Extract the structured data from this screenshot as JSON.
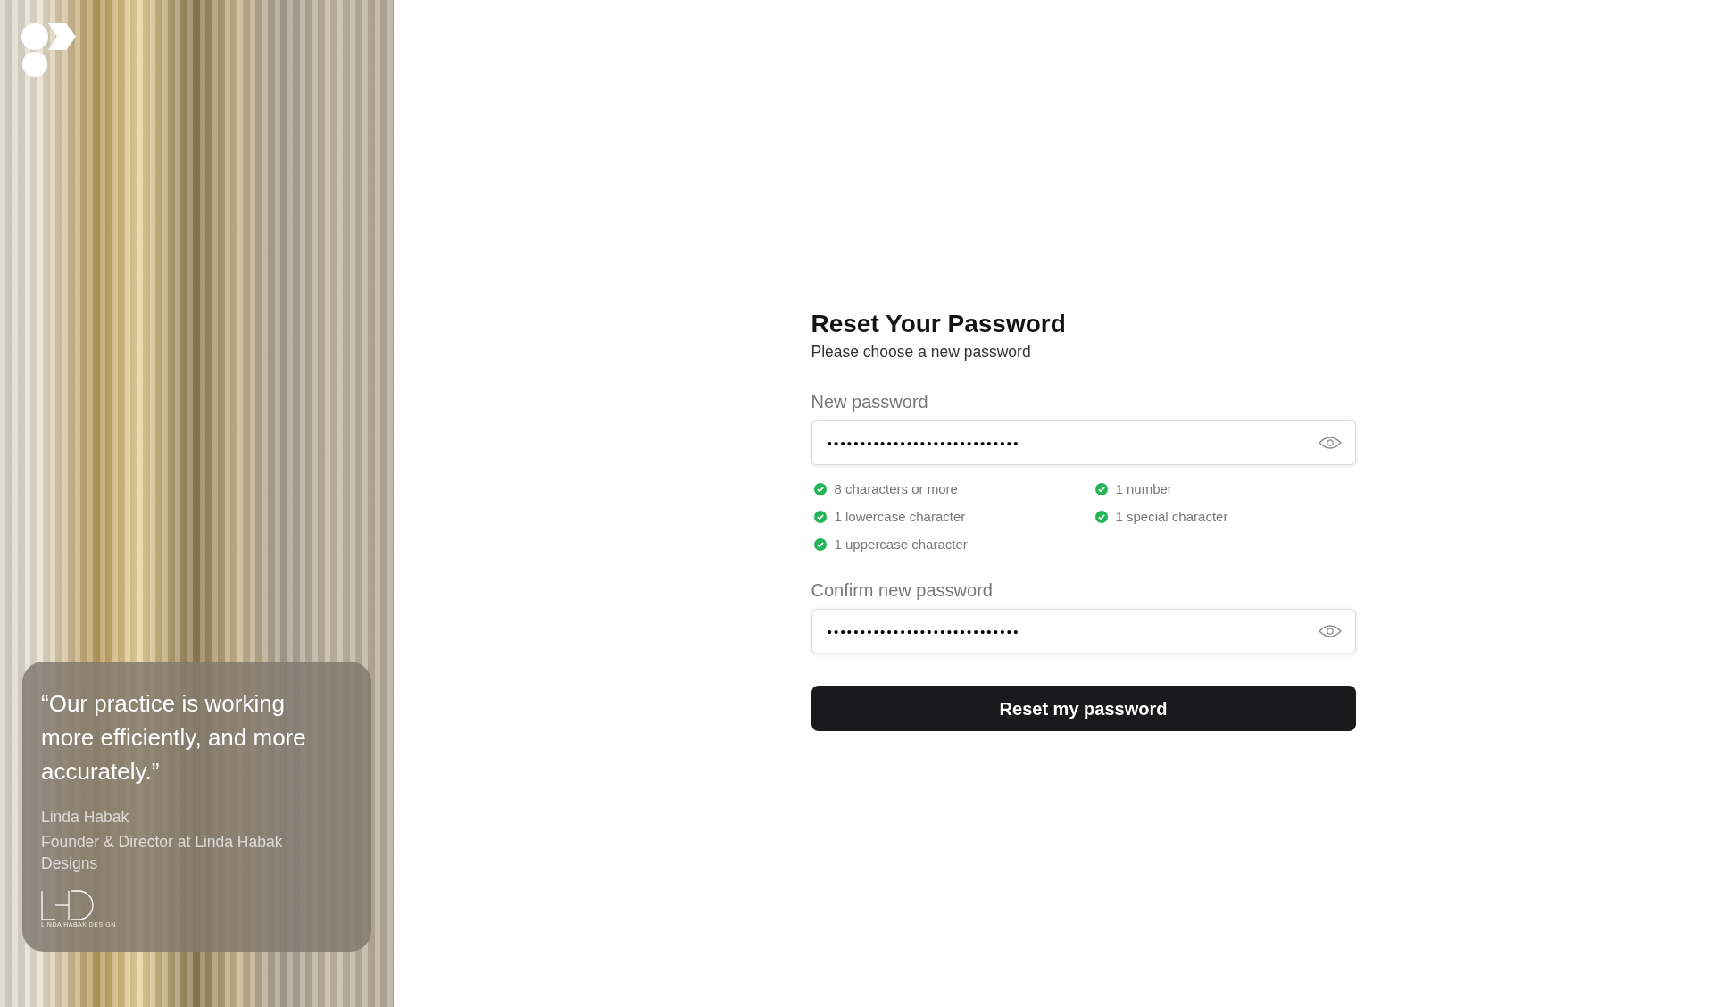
{
  "testimonial": {
    "quote": "“Our practice is working more efficiently, and more accurately.”",
    "author": "Linda Habak",
    "role": "Founder & Director at Linda Habak Designs",
    "company_logo_caption": "LINDA HABAK DESIGN"
  },
  "form": {
    "title": "Reset Your Password",
    "subtitle": "Please choose a new password",
    "fields": [
      {
        "label": "New password",
        "value": "•••••••••••••••••••••••••••••",
        "show_toggle": true,
        "requirements": [
          {
            "text": "8 characters or more",
            "met": true
          },
          {
            "text": "1 number",
            "met": true
          },
          {
            "text": "1 lowercase character",
            "met": true
          },
          {
            "text": "1 special character",
            "met": true
          },
          {
            "text": "1 uppercase character",
            "met": true
          }
        ]
      },
      {
        "label": "Confirm new password",
        "value": "•••••••••••••••••••••••••••••",
        "show_toggle": true
      }
    ],
    "submit": "Reset my password"
  }
}
